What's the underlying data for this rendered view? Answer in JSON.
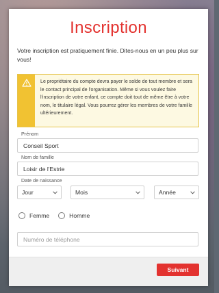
{
  "modal": {
    "title": "Inscription",
    "intro": "Votre inscription est pratiquement finie. Dites-nous en un peu plus sur vous!"
  },
  "warning": {
    "icon": "warning-triangle-icon",
    "text": "Le propriétaire du compte devra payer le solde de tout membre et sera le contact principal de l'organisation. Même si vous voulez faire l'inscription de votre enfant, ce compte doit tout de même être à votre nom, le titulaire légal. Vous pourrez gérer les membres de votre famille ultérieurement."
  },
  "form": {
    "first_name": {
      "label": "Prénom",
      "value": "Conseil Sport"
    },
    "last_name": {
      "label": "Nom de famille",
      "value": "Loisir de l'Estrie"
    },
    "birthdate": {
      "label": "Date de naissance",
      "day": "Jour",
      "month": "Mois",
      "year": "Année"
    },
    "gender": {
      "female": "Femme",
      "male": "Homme"
    },
    "phone": {
      "placeholder": "Numéro de téléphone"
    }
  },
  "footer": {
    "submit_label": "Suivant"
  },
  "colors": {
    "accent": "#e3322f",
    "warning_strip": "#f1c232",
    "warning_bg": "#fdf9e2"
  }
}
